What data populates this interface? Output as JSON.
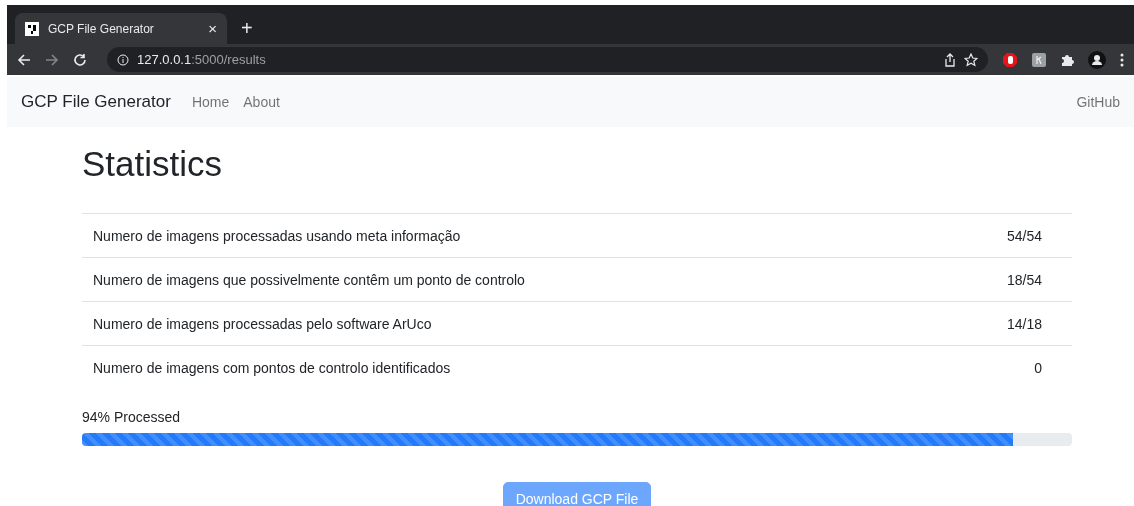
{
  "browser": {
    "tab_title": "GCP File Generator",
    "tab_close": "×",
    "new_tab": "+",
    "url_host": "127.0.0.1",
    "url_path": ":5000/results"
  },
  "navbar": {
    "brand": "GCP File Generator",
    "links": [
      {
        "label": "Home"
      },
      {
        "label": "About"
      }
    ],
    "right_link": "GitHub"
  },
  "heading": "Statistics",
  "stats": [
    {
      "label": "Numero de imagens processadas usando meta informação",
      "value": "54/54"
    },
    {
      "label": "Numero de imagens que possivelmente contêm um ponto de controlo",
      "value": "18/54"
    },
    {
      "label": "Numero de imagens processadas pelo software ArUco",
      "value": "14/18"
    },
    {
      "label": "Numero de imagens com pontos de controlo identificados",
      "value": "0"
    }
  ],
  "progress": {
    "label": "94% Processed",
    "level": 0.94,
    "striped": true
  },
  "download_button": {
    "label": "Download GCP File",
    "disabled": true
  }
}
